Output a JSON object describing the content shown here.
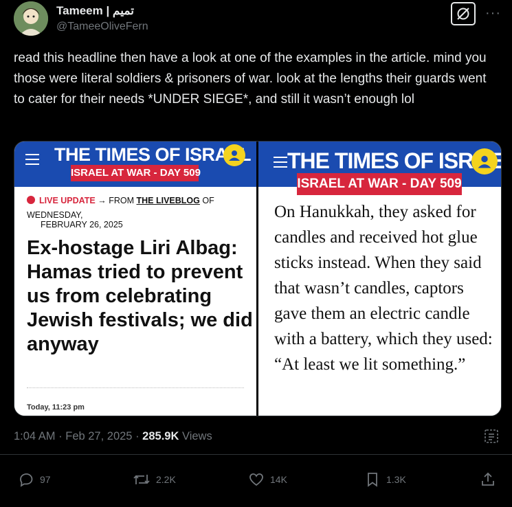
{
  "author": {
    "display_name": "Tameem | تميم",
    "handle": "@TameeOliveFern"
  },
  "tweet": {
    "text": "read this headline then have a look at one of the examples in the article. mind you those were literal soldiers & prisoners of war. look at the lengths their guards went to cater for their needs *UNDER SIEGE*, and still it wasn’t enough lol"
  },
  "media": {
    "left": {
      "masthead": "THE TIMES OF ISRAEL",
      "tag": "ISRAEL AT WAR - DAY 509",
      "live_label": "LIVE UPDATE",
      "arrow": "→",
      "from_text": "FROM",
      "liveblog": "THE LIVEBLOG",
      "of_text": "OF",
      "weekday": "WEDNESDAY,",
      "date": "FEBRUARY 26, 2025",
      "headline": "Ex-hostage Liri Albag: Hamas tried to prevent us from celebrating Jewish festivals; we did anyway",
      "timestamp": "Today, 11:23 pm"
    },
    "right": {
      "masthead": "THE TIMES OF ISRAE",
      "tag": "ISRAEL AT WAR - DAY 509",
      "quote": "On Hanukkah, they asked for candles and received hot glue sticks instead. When they said that wasn’t candles, captors gave them an electric candle with a battery, which they used: “At least we lit something.”"
    }
  },
  "meta": {
    "time": "1:04 AM",
    "dot": "·",
    "date": "Feb 27, 2025",
    "views_count": "285.9K",
    "views_label": "Views"
  },
  "actions": {
    "replies": "97",
    "reposts": "2.2K",
    "likes": "14K",
    "bookmarks": "1.3K"
  },
  "more_glyph": "···",
  "colors": {
    "background": "#000000",
    "text": "#e7e9ea",
    "muted": "#71767b",
    "toi_blue": "#1a4bb0",
    "toi_red": "#d7263d",
    "toi_yellow": "#f4d31e"
  }
}
